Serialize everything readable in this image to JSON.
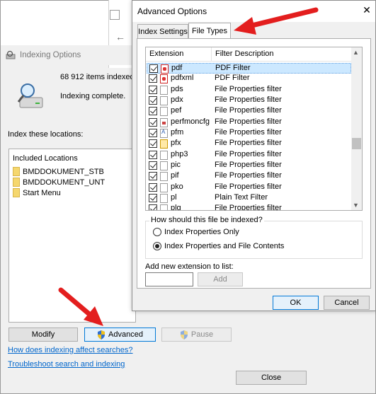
{
  "main_window": {
    "title": "Indexing Options",
    "items_indexed": "68 912 items indexed",
    "status": "Indexing complete.",
    "index_label": "Index these locations:",
    "locations_header": "Included Locations",
    "locations": [
      "BMDDOKUMENT_STB",
      "BMDDOKUMENT_UNT",
      "Start Menu"
    ],
    "buttons": {
      "modify": "Modify",
      "advanced": "Advanced",
      "pause": "Pause",
      "close": "Close"
    },
    "links": {
      "how_indexing": "How does indexing affect searches?",
      "troubleshoot": "Troubleshoot search and indexing"
    },
    "icons": [
      "drive-search-icon",
      "shield-icon"
    ]
  },
  "dialog": {
    "title": "Advanced Options",
    "close_glyph": "✕",
    "tabs": [
      "Index Settings",
      "File Types"
    ],
    "active_tab": "File Types",
    "columns": {
      "extension": "Extension",
      "description": "Filter Description"
    },
    "file_types": [
      {
        "ext": "pdf",
        "desc": "PDF Filter",
        "icon": "pdf-icon",
        "selected": true
      },
      {
        "ext": "pdfxml",
        "desc": "PDF Filter",
        "icon": "pdf-icon"
      },
      {
        "ext": "pds",
        "desc": "File Properties filter",
        "icon": "file-icon"
      },
      {
        "ext": "pdx",
        "desc": "File Properties filter",
        "icon": "file-icon"
      },
      {
        "ext": "pef",
        "desc": "File Properties filter",
        "icon": "file-icon"
      },
      {
        "ext": "perfmoncfg",
        "desc": "File Properties filter",
        "icon": "image-file-icon"
      },
      {
        "ext": "pfm",
        "desc": "File Properties filter",
        "icon": "font-file-icon"
      },
      {
        "ext": "pfx",
        "desc": "File Properties filter",
        "icon": "certificate-icon"
      },
      {
        "ext": "php3",
        "desc": "File Properties filter",
        "icon": "file-icon"
      },
      {
        "ext": "pic",
        "desc": "File Properties filter",
        "icon": "file-icon"
      },
      {
        "ext": "pif",
        "desc": "File Properties filter",
        "icon": "file-icon"
      },
      {
        "ext": "pko",
        "desc": "File Properties filter",
        "icon": "file-icon"
      },
      {
        "ext": "pl",
        "desc": "Plain Text Filter",
        "icon": "file-icon"
      },
      {
        "ext": "plg",
        "desc": "File Properties filter",
        "icon": "file-icon"
      }
    ],
    "index_question": "How should this file be indexed?",
    "radio_options": [
      "Index Properties Only",
      "Index Properties and File Contents"
    ],
    "selected_option": "Index Properties and File Contents",
    "add_label": "Add new extension to list:",
    "add_value": "",
    "buttons": {
      "add": "Add",
      "ok": "OK",
      "cancel": "Cancel"
    }
  },
  "annotation_color": "#e31e1e"
}
